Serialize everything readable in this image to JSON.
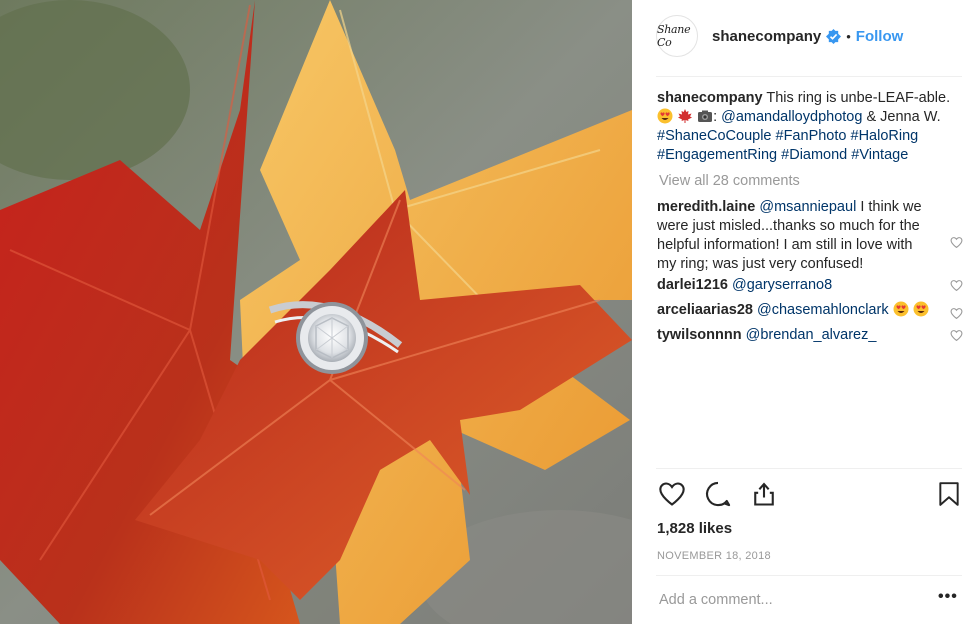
{
  "post": {
    "account": {
      "avatar_text": "Shane Co",
      "username": "shanecompany",
      "separator": "•",
      "follow_label": "Follow"
    },
    "caption": {
      "username": "shanecompany",
      "text_1": "This ring is unbe-LEAF-able.",
      "text_2": ":",
      "mention": "@amandalloydphotog",
      "text_3": "& Jenna W.",
      "hashtags": [
        "#ShaneCoCouple",
        "#FanPhoto",
        "#HaloRing",
        "#EngagementRing",
        "#Diamond",
        "#Vintage"
      ]
    },
    "view_all": "View all 28 comments",
    "comments": [
      {
        "username": "meredith.laine",
        "mention": "@msanniepaul",
        "text": "I think we were just misled...thanks so much for the helpful information! I am still in love with my ring; was just very confused!"
      },
      {
        "username": "darlei1216",
        "mention": "@garyserrano8",
        "text": ""
      },
      {
        "username": "arceliaarias28",
        "mention": "@chasemahlonclark",
        "text": ""
      },
      {
        "username": "tywilsonnnn",
        "mention": "@brendan_alvarez_",
        "text": ""
      }
    ],
    "likes": "1,828 likes",
    "date": "NOVEMBER 18, 2018",
    "add_comment_placeholder": "Add a comment...",
    "more_label": "•••"
  },
  "colors": {
    "link": "#003569",
    "follow": "#3897f0",
    "muted": "#999999",
    "text": "#262626"
  },
  "icons": [
    "verified-badge-icon",
    "heart-icon",
    "comment-icon",
    "share-icon",
    "bookmark-icon",
    "more-icon"
  ]
}
